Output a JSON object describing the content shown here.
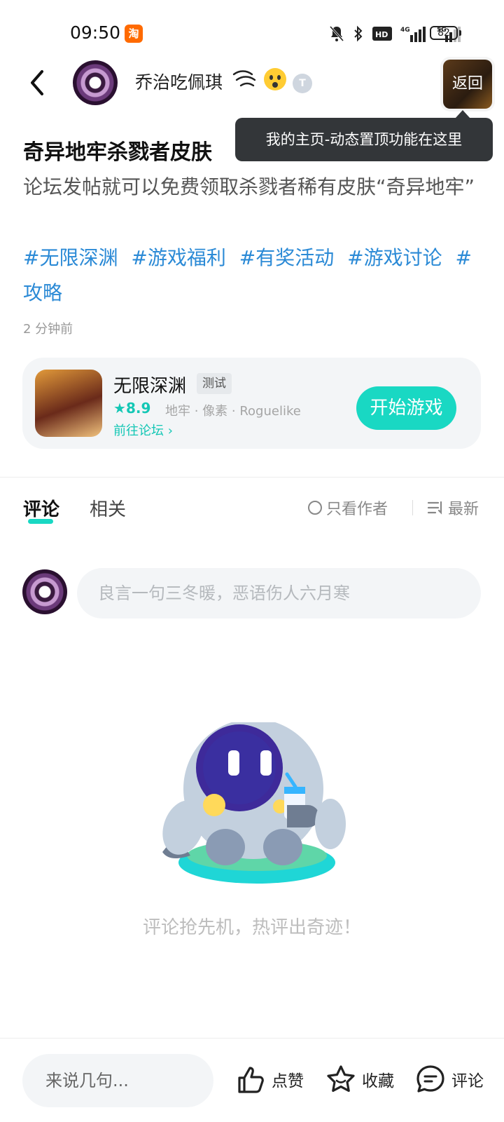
{
  "status_bar": {
    "time": "09:50",
    "taobao_icon": "淘",
    "battery": "82",
    "network_labels": [
      "HD2",
      "4G",
      "5G"
    ]
  },
  "header": {
    "username": "乔治吃佩琪",
    "badge": "T",
    "return_label": "返回"
  },
  "tooltip": "我的主页-动态置顶功能在这里",
  "post": {
    "title": "奇异地牢杀戮者皮肤",
    "body": "论坛发帖就可以免费领取杀戮者稀有皮肤“奇异地牢”",
    "tags": [
      "#无限深渊",
      "#游戏福利",
      "#有奖活动",
      "#游戏讨论",
      "#攻略"
    ],
    "time": "2 分钟前"
  },
  "game_card": {
    "name": "无限深渊",
    "tag": "测试",
    "rating": "8.9",
    "meta": "地牢 · 像素 · Roguelike",
    "forum_link": "前往论坛",
    "play_label": "开始游戏"
  },
  "tabs": {
    "comments": "评论",
    "related": "相关",
    "author_only": "只看作者",
    "sort": "最新"
  },
  "comment_box": {
    "placeholder": "良言一句三冬暖，恶语伤人六月寒"
  },
  "empty_state": "评论抢先机，热评出奇迹！",
  "bottom_bar": {
    "input_placeholder": "来说几句...",
    "like": "点赞",
    "favorite": "收藏",
    "comment": "评论"
  },
  "colors": {
    "accent": "#19d8c3",
    "tag_blue": "#2b8ad6",
    "tooltip_bg": "#333639"
  }
}
